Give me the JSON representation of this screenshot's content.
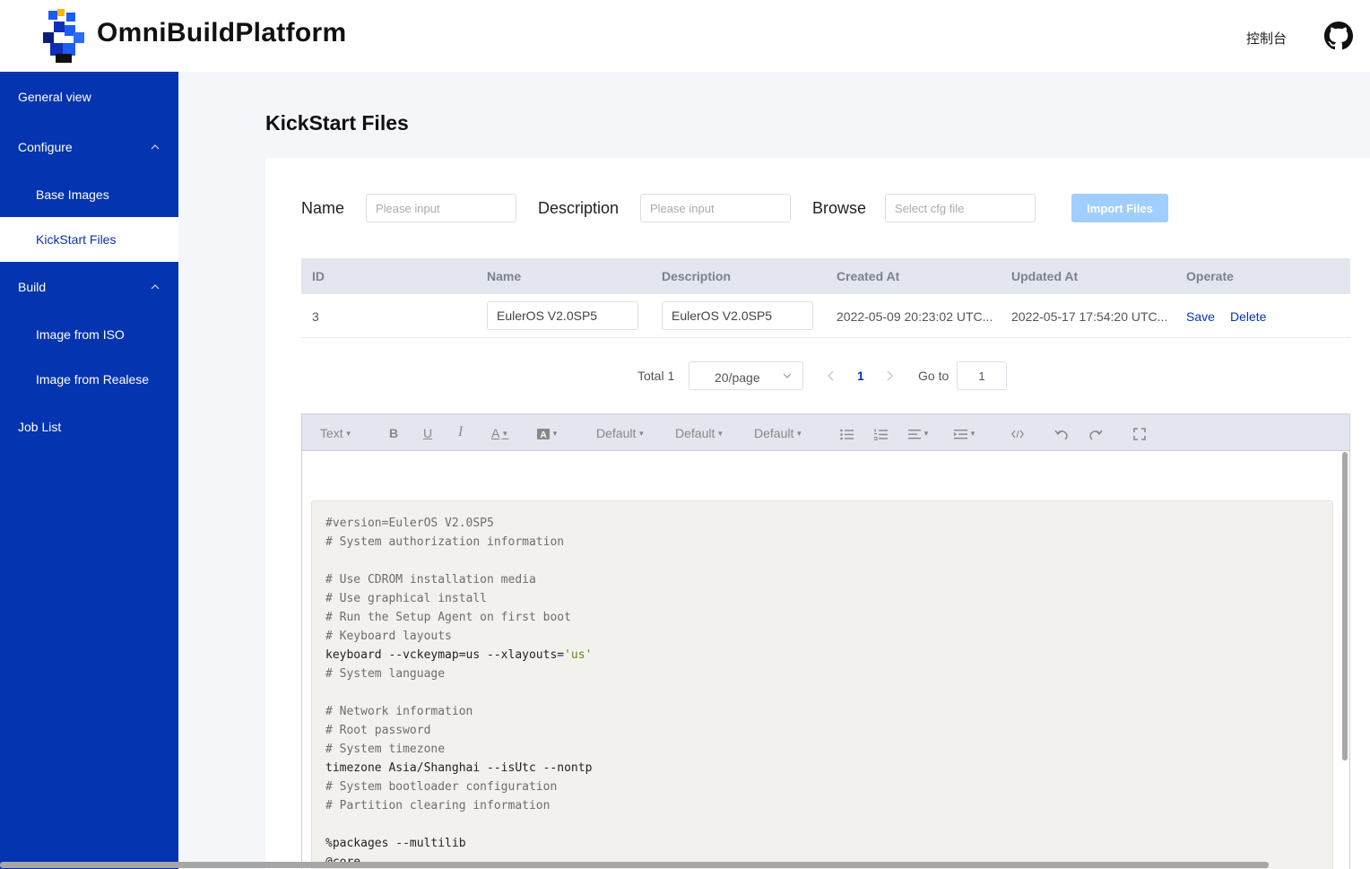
{
  "header": {
    "brand": "OmniBuildPlatform",
    "console_label": "控制台",
    "github_icon": "github-icon"
  },
  "sidebar": {
    "items": [
      {
        "label": "General view"
      },
      {
        "label": "Configure",
        "expanded": true
      },
      {
        "label": "Base Images"
      },
      {
        "label": "KickStart Files",
        "active": true
      },
      {
        "label": "Build",
        "expanded": true
      },
      {
        "label": "Image from ISO"
      },
      {
        "label": "Image from Realese"
      },
      {
        "label": "Job List"
      }
    ]
  },
  "page": {
    "title": "KickStart Files"
  },
  "form": {
    "name_label": "Name",
    "name_placeholder": "Please input",
    "description_label": "Description",
    "description_placeholder": "Please input",
    "browse_label": "Browse",
    "browse_placeholder": "Select cfg file",
    "import_button": "Import Files"
  },
  "table": {
    "columns": [
      "ID",
      "Name",
      "Description",
      "Created At",
      "Updated At",
      "Operate"
    ],
    "rows": [
      {
        "id": "3",
        "name": "EulerOS V2.0SP5",
        "description": "EulerOS V2.0SP5",
        "created_at": "2022-05-09 20:23:02 UTC...",
        "updated_at": "2022-05-17 17:54:20 UTC...",
        "save_label": "Save",
        "delete_label": "Delete"
      }
    ]
  },
  "pagination": {
    "total": "Total 1",
    "page_size": "20/page",
    "current_page": "1",
    "goto_label": "Go to",
    "goto_value": "1"
  },
  "editor": {
    "toolbar": {
      "text": "Text",
      "bold": "B",
      "underline": "U",
      "italic": "I",
      "font_color": "A",
      "default1": "Default",
      "default2": "Default",
      "default3": "Default"
    },
    "code_lines": [
      "#version=EulerOS V2.0SP5",
      "# System authorization information",
      "",
      "# Use CDROM installation media",
      "# Use graphical install",
      "# Run the Setup Agent on first boot",
      "# Keyboard layouts",
      "keyboard --vckeymap=us --xlayouts=",
      "'us'",
      "# System language",
      "",
      "# Network information",
      "# Root password",
      "# System timezone",
      "timezone Asia/Shanghai --isUtc --nontp",
      "# System bootloader configuration",
      "# Partition clearing information",
      "",
      "%packages --multilib",
      "@core"
    ]
  },
  "colors": {
    "sidebar_bg": "#0434b0",
    "accent": "#0434b0",
    "import_button_bg": "#a0cfff",
    "table_header_bg": "#e3e6ee",
    "code_bg": "#f3f1ee",
    "string_color": "#5b8c21"
  }
}
